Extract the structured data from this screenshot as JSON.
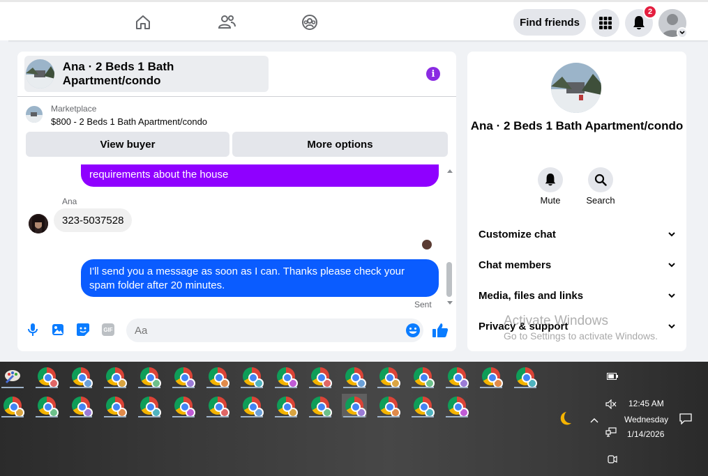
{
  "nav": {
    "find_friends": "Find friends",
    "notification_count": "2"
  },
  "chat": {
    "header_title": "Ana · 2 Beds 1 Bath Apartment/condo",
    "marketplace_label": "Marketplace",
    "listing_title": "$800 - 2 Beds 1 Bath Apartment/condo",
    "view_buyer": "View buyer",
    "more_options": "More options",
    "messages": {
      "purple_text": "requirements about the house",
      "sender_name": "Ana",
      "grey_text": "323-5037528",
      "blue_text": "I'll send you a message as soon as I can. Thanks please check your spam folder after 20 minutes.",
      "sent_status": "Sent"
    },
    "composer_placeholder": "Aa",
    "gif_label": "GIF"
  },
  "profile": {
    "name": "Ana · 2 Beds 1 Bath Apartment/condo",
    "mute_label": "Mute",
    "search_label": "Search",
    "menu": [
      {
        "label": "Customize chat"
      },
      {
        "label": "Chat members"
      },
      {
        "label": "Media, files and links"
      },
      {
        "label": "Privacy & support"
      }
    ]
  },
  "watermark": {
    "line1": "Activate Windows",
    "line2": "Go to Settings to activate Windows."
  },
  "taskbar": {
    "time": "12:45 AM",
    "day": "Wednesday",
    "date": "1/14/2026"
  },
  "colors": {
    "purple_bubble": "#8f00ff",
    "blue_bubble": "#0a5cff",
    "like_blue": "#0a7cff",
    "badge_red": "#e41e3f"
  }
}
